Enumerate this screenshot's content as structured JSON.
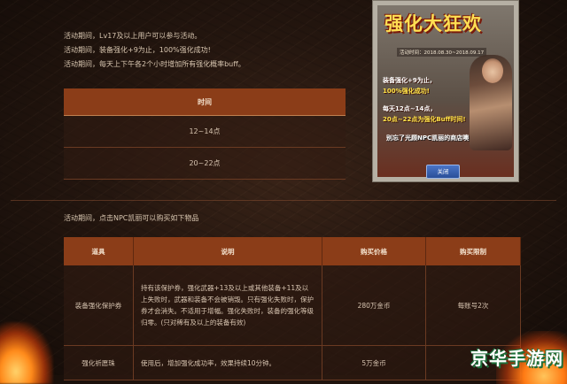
{
  "activity": {
    "lines": [
      "活动期间，Lv17及以上用户可以参与活动。",
      "活动期间，装备强化+9为止，100%强化成功!",
      "活动期间，每天上下午各2个小时增加所有强化概率buff。"
    ]
  },
  "time_table": {
    "header": "时间",
    "rows": [
      "12~14点",
      "20~22点"
    ]
  },
  "banner": {
    "title": "强化大狂欢",
    "date": "活动时间：2018.08.30~2018.09.17",
    "feature1": "装备强化+9为止，",
    "feature2": "100%强化成功!",
    "feature3": "每天12点~14点，",
    "feature4": "20点~22点为强化Buff时间!",
    "footer": "别忘了光顾NPC凯丽的商店噢",
    "close_label": "关闭"
  },
  "shop": {
    "note": "活动期间，点击NPC凯丽可以购买如下物品",
    "headers": [
      "道具",
      "说明",
      "购买价格",
      "购买限制"
    ],
    "rows": [
      {
        "item": "装备强化保护券",
        "desc": "持有该保护券，强化武器+13及以上或其他装备+11及以上失败时，武器和装备不会被销毁。只有强化失败时，保护券才会消失。不适用于增幅。强化失败时，装备的强化等级归零。(只对稀有及以上的装备有效)",
        "price": "280万金币",
        "limit": "每账号2次"
      },
      {
        "item": "强化祈愿珠",
        "desc": "使用后，增加强化成功率，效果持续10分钟。",
        "price": "5万金币",
        "limit": ""
      }
    ]
  },
  "watermark": "京华手游网"
}
